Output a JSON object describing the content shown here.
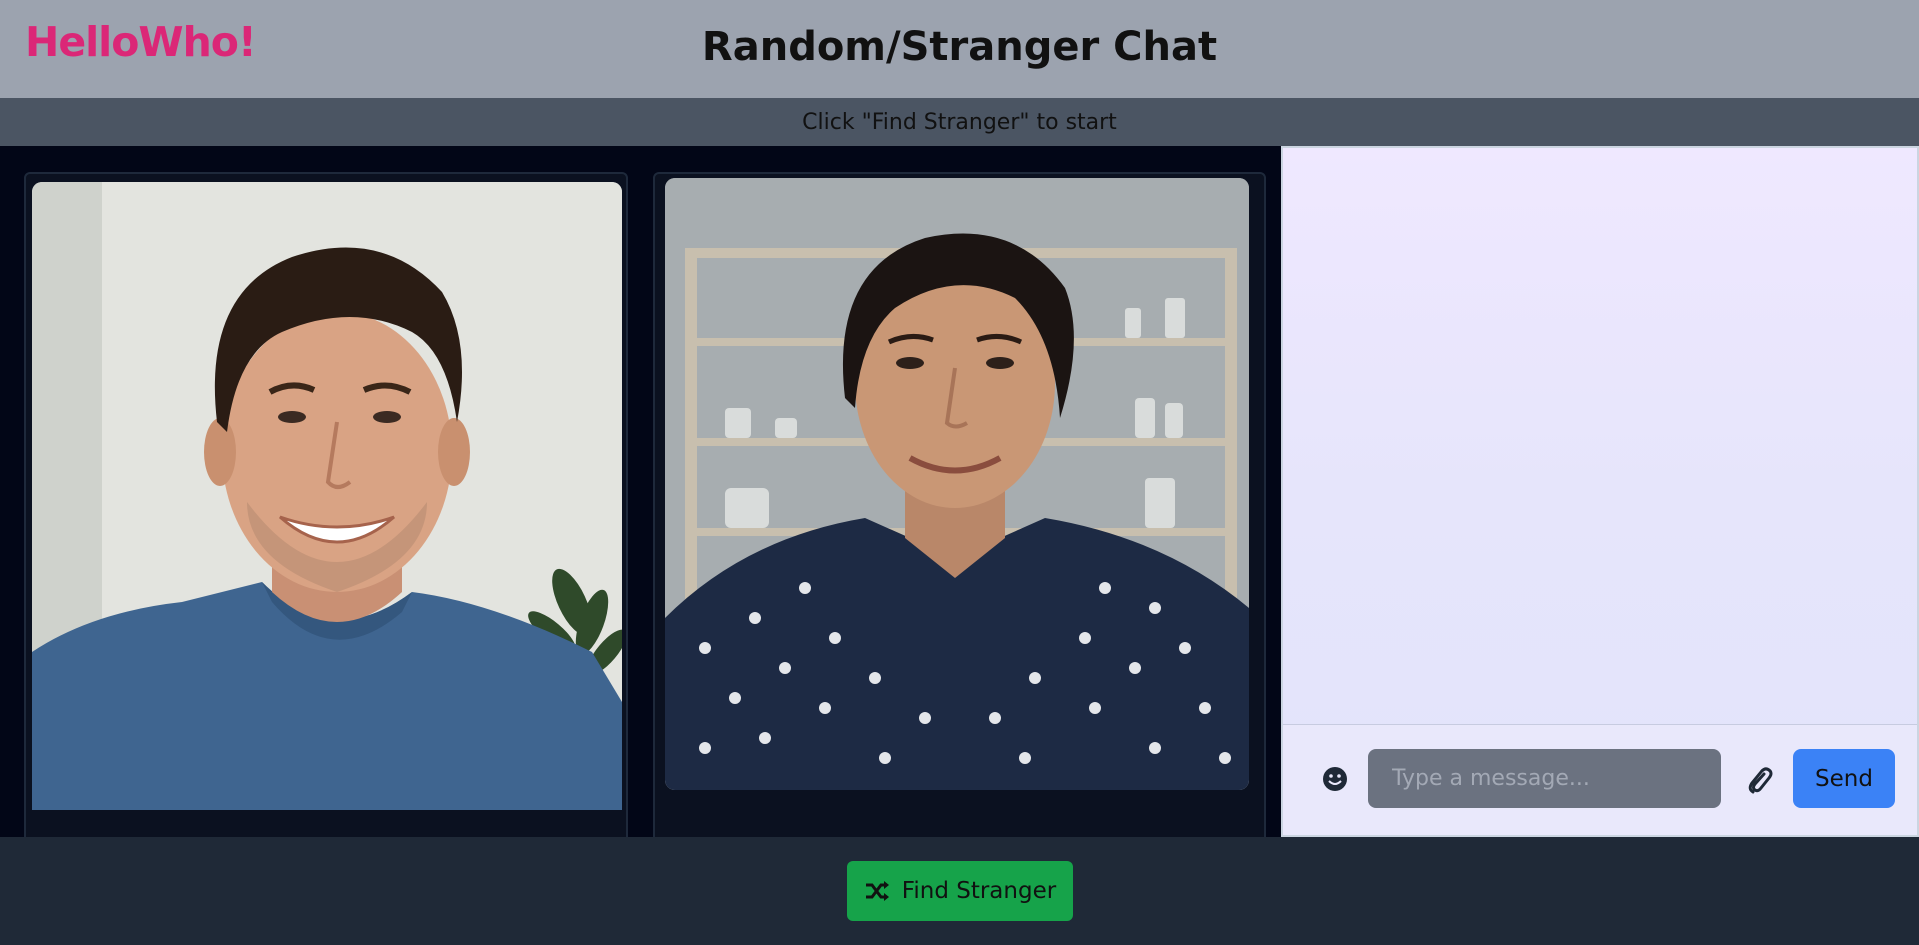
{
  "header": {
    "logo": "HelloWho!",
    "title": "Random/Stranger Chat"
  },
  "status": {
    "text": "Click \"Find Stranger\" to start"
  },
  "videos": {
    "local": {
      "description": "smiling man in blue t-shirt"
    },
    "remote": {
      "description": "smiling woman in polka-dot blouse"
    }
  },
  "call_controls": {
    "mic_icon": "microphone-icon",
    "camera_icon": "video-camera-icon"
  },
  "chat": {
    "input_placeholder": "Type a message...",
    "send_label": "Send",
    "emoji_icon": "smiley-icon",
    "attach_icon": "paperclip-icon"
  },
  "footer": {
    "find_label": "Find Stranger",
    "find_icon": "shuffle-icon"
  },
  "colors": {
    "brand": "#db2777",
    "send": "#3b82f6",
    "find": "#16a34a",
    "controls": "#22c55e"
  }
}
